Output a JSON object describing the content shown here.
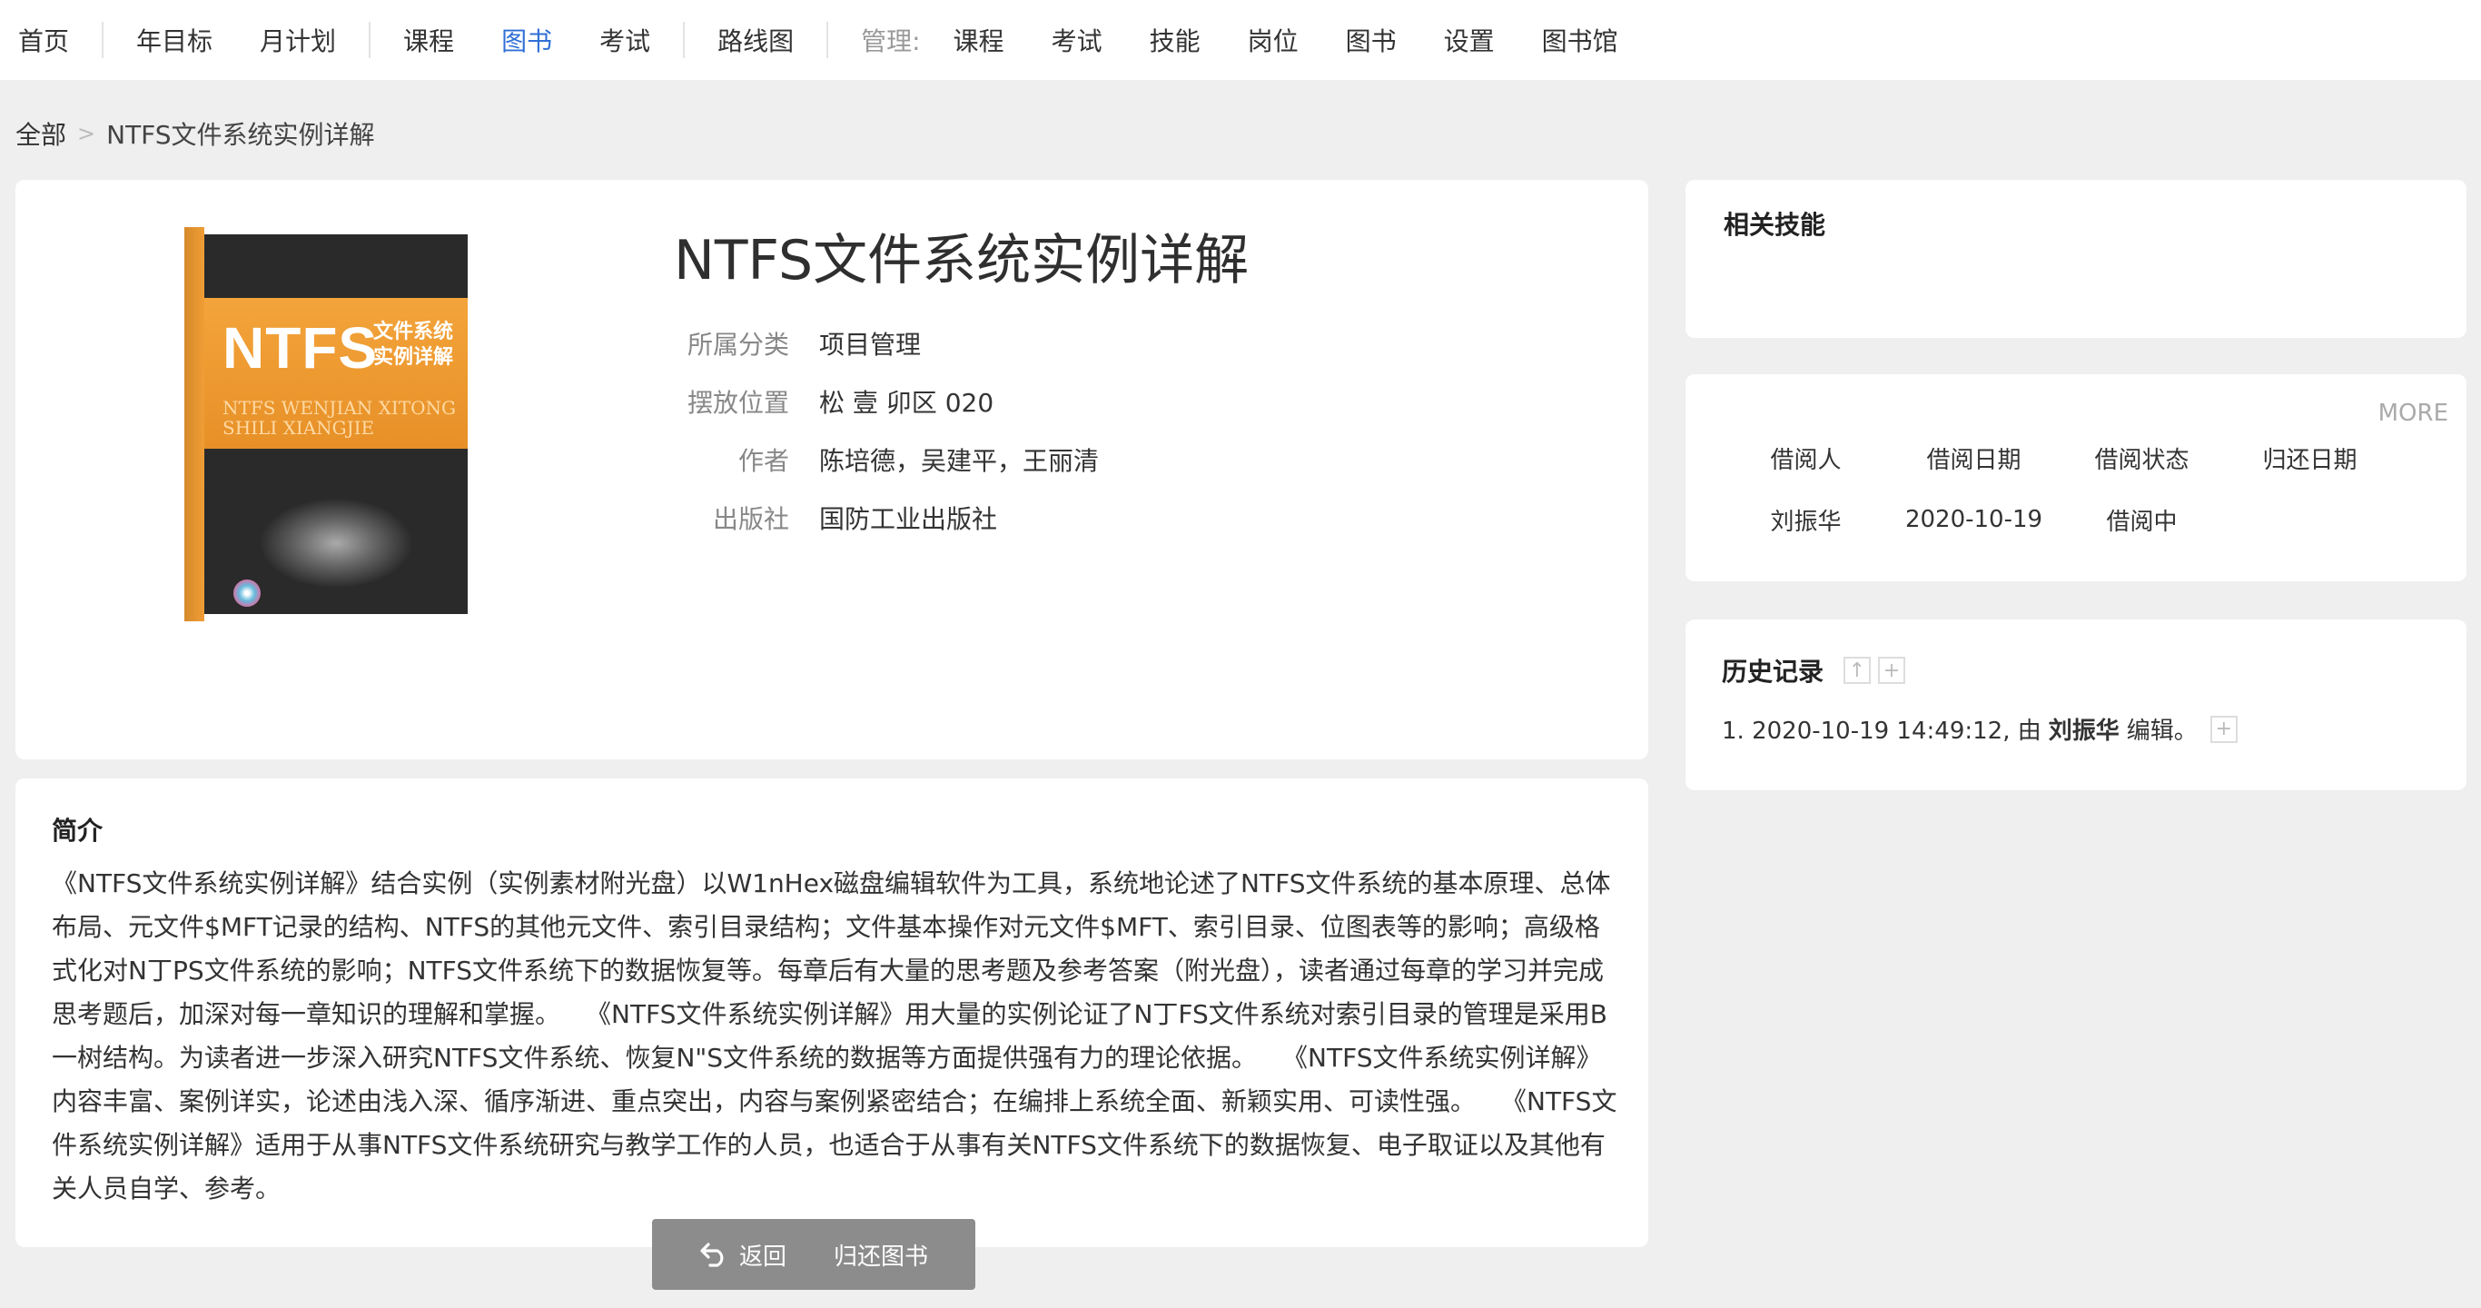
{
  "nav": {
    "items": [
      {
        "label": "首页"
      },
      {
        "label": "年目标"
      },
      {
        "label": "月计划"
      },
      {
        "label": "课程"
      },
      {
        "label": "图书",
        "active": true
      },
      {
        "label": "考试"
      },
      {
        "label": "路线图"
      }
    ],
    "admin_label": "管理:",
    "admin_items": [
      "课程",
      "考试",
      "技能",
      "岗位",
      "图书",
      "设置",
      "图书馆"
    ]
  },
  "breadcrumb": {
    "root": "全部",
    "separator": ">",
    "current": "NTFS文件系统实例详解"
  },
  "book": {
    "title": "NTFS文件系统实例详解",
    "cover": {
      "big": "NTFS",
      "sub": "文件系统实例详解",
      "roman": "NTFS WENJIAN XITONG SHILI XIANGJIE"
    },
    "fields": [
      {
        "label": "所属分类",
        "value": "项目管理"
      },
      {
        "label": "摆放位置",
        "value": "松 壹 卯区 020"
      },
      {
        "label": "作者",
        "value": "陈培德，吴建平，王丽清"
      },
      {
        "label": "出版社",
        "value": "国防工业出版社"
      }
    ]
  },
  "intro": {
    "heading": "简介",
    "text": "《NTFS文件系统实例详解》结合实例（实例素材附光盘）以W1nHex磁盘编辑软件为工具，系统地论述了NTFS文件系统的基本原理、总体布局、元文件$MFT记录的结构、NTFS的其他元文件、索引目录结构；文件基本操作对元文件$MFT、索引目录、位图表等的影响；高级格式化对N丁PS文件系统的影响；NTFS文件系统下的数据恢复等。每章后有大量的思考题及参考答案（附光盘），读者通过每章的学习并完成思考题后，加深对每一章知识的理解和掌握。　　《NTFS文件系统实例详解》用大量的实例论证了N丁FS文件系统对索引目录的管理是采用B一树结构。为读者进一步深入研究NTFS文件系统、恢复N\"S文件系统的数据等方面提供强有力的理论依据。　　《NTFS文件系统实例详解》内容丰富、案例详实，论述由浅入深、循序渐进、重点突出，内容与案例紧密结合；在编排上系统全面、新颖实用、可读性强。　　《NTFS文件系统实例详解》适用于从事NTFS文件系统研究与教学工作的人员，也适合于从事有关NTFS文件系统下的数据恢复、电子取证以及其他有关人员自学、参考。"
  },
  "skills": {
    "heading": "相关技能"
  },
  "borrow": {
    "more": "MORE",
    "headers": [
      "借阅人",
      "借阅日期",
      "借阅状态",
      "归还日期"
    ],
    "rows": [
      [
        "刘振华",
        "2020-10-19",
        "借阅中",
        ""
      ]
    ]
  },
  "history": {
    "heading": "历史记录",
    "entry_prefix": "1. 2020-10-19 14:49:12, 由",
    "entry_user": "刘振华",
    "entry_suffix": "编辑。"
  },
  "actions": {
    "back": "返回",
    "return_book": "归还图书"
  },
  "colors": {
    "accent": "#2f6fd6",
    "background": "#efefef",
    "action_bar": "#8c8c8c"
  }
}
